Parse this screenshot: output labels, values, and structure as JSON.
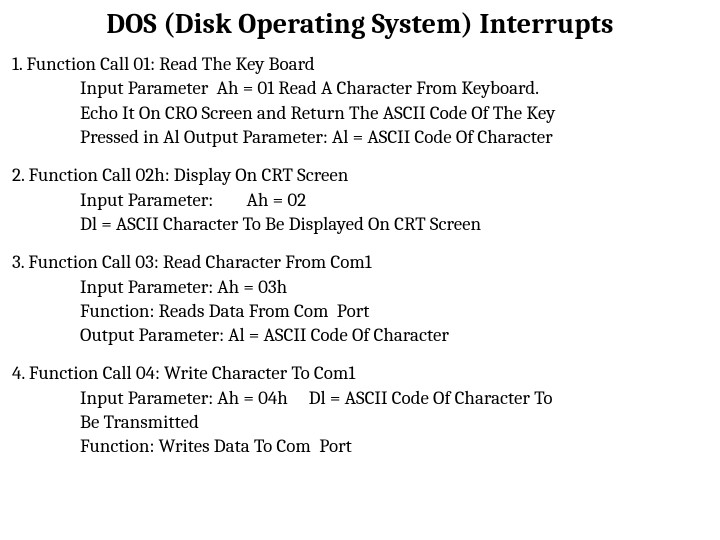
{
  "title": "DOS (Disk Operating System)  Interrupts",
  "entries": [
    {
      "num": "1.",
      "head": "Function Call 01: Read The Key Board",
      "body": "Input Parameter  Ah = 01 Read A Character From Keyboard.\nEcho It On CRO Screen and Return The ASCII Code Of The Key\nPressed in Al Output Parameter: Al = ASCII Code Of Character"
    },
    {
      "num": "2.",
      "head": "Function Call 02h: Display On CRT Screen",
      "body": "Input Parameter:        Ah = 02\nDl = ASCII Character To Be Displayed On CRT Screen"
    },
    {
      "num": "3.",
      "head": "Function Call 03: Read Character From Com1",
      "body": "Input Parameter: Ah = 03h\nFunction: Reads Data From Com  Port\nOutput Parameter: Al = ASCII Code Of Character"
    },
    {
      "num": "4.",
      "head": "Function Call 04: Write Character To Com1",
      "body": "Input Parameter: Ah = 04h     Dl = ASCII Code Of Character To\nBe Transmitted\nFunction: Writes Data To Com  Port"
    }
  ]
}
